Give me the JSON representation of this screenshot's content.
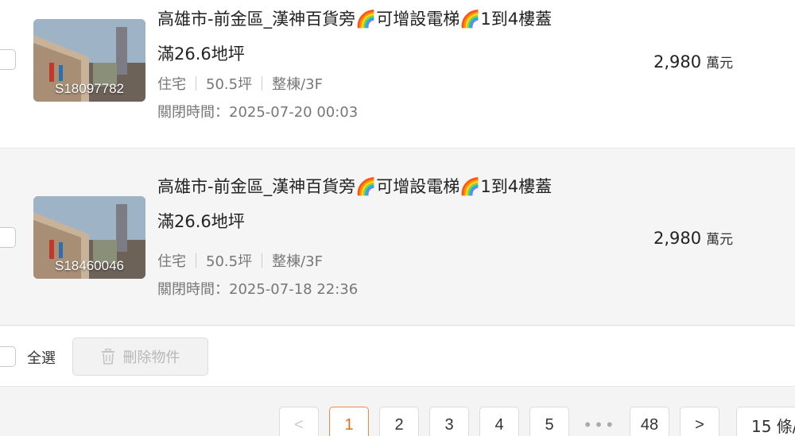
{
  "listings": [
    {
      "title_line1": "高雄市-前金區_漢神百貨旁🌈可增設電梯🌈1到4樓蓋",
      "title_line2": "滿26.6地坪",
      "code": "S18097782",
      "type": "住宅",
      "area": "50.5坪",
      "floor": "整棟/3F",
      "closed": "關閉時間：2025-07-20 00:03",
      "price": "2,980",
      "price_unit": "萬元"
    },
    {
      "title_line1": "高雄市-前金區_漢神百貨旁🌈可增設電梯🌈1到4樓蓋",
      "title_line2": "滿26.6地坪",
      "code": "S18460046",
      "type": "住宅",
      "area": "50.5坪",
      "floor": "整棟/3F",
      "closed": "關閉時間：2025-07-18 22:36",
      "price": "2,980",
      "price_unit": "萬元"
    }
  ],
  "footer": {
    "select_all": "全選",
    "delete_label": "刪除物件"
  },
  "pagination": {
    "prev": "<",
    "pages": [
      "1",
      "2",
      "3",
      "4",
      "5"
    ],
    "ellipsis": "•••",
    "last": "48",
    "next": ">",
    "per_page": "15 條/"
  },
  "colors": {
    "accent": "#e06d20",
    "active_border": "#e88a4a"
  },
  "icons": {
    "delete": "trash-icon",
    "prev": "chevron-left-icon",
    "next": "chevron-right-icon"
  }
}
